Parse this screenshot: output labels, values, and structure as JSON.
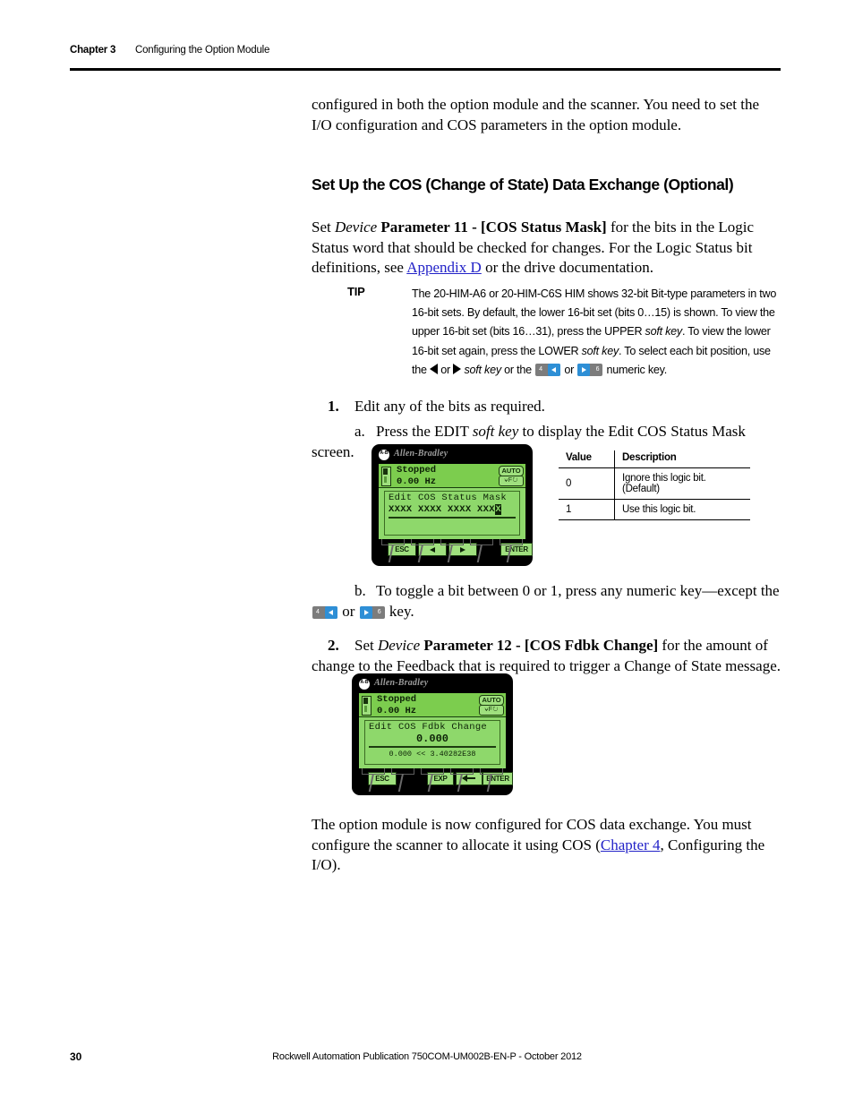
{
  "header": {
    "chapter": "Chapter 3",
    "title": "Configuring the Option Module"
  },
  "intro_paragraph": "configured in both the option module and the scanner. You need to set the I/O configuration and COS parameters in the option module.",
  "section": {
    "title": "Set Up the COS (Change of State) Data Exchange (Optional)",
    "para_set": "Set",
    "para_device": "Device",
    "para_param": "Parameter 11 - [COS Status Mask]",
    "para_rest1": " for the bits in the Logic Status word that should be checked for changes. For the Logic Status bit definitions, see ",
    "para_link": "Appendix D",
    "para_rest2": " or the drive documentation."
  },
  "tip": {
    "label": "TIP",
    "text_a": "The 20-HIM-A6 or 20-HIM-C6S HIM shows 32-bit Bit-type parameters in two 16-bit sets. By default, the lower 16-bit set (bits 0…15) is shown. To view the upper 16-bit set (bits 16…31), press the UPPER ",
    "soft_key_1": "soft key",
    "text_b": ". To view the lower 16-bit set again, press the LOWER ",
    "soft_key_2": "soft key",
    "text_c": ". To select each bit position, use the ",
    "text_d": " or ",
    "soft_key_3": "soft key",
    "text_e": " or the ",
    "text_f": " or ",
    "text_g": " numeric key.",
    "key_4_label": "4",
    "key_6_label": "6"
  },
  "steps": {
    "step1_num": "1.",
    "step1_text": "Edit any of the bits as required.",
    "step1a_num": "a.",
    "step1a_text_1": "Press the EDIT ",
    "step1a_italic": "soft key",
    "step1a_text_2": " to display the Edit COS Status Mask screen.",
    "step1b_num": "b.",
    "step1b_text_1": "To toggle a bit between 0 or 1, press any numeric key—except the ",
    "step1b_text_2": " or ",
    "step1b_text_3": " key.",
    "step2_num": "2.",
    "step2_set": "Set ",
    "step2_device": "Device",
    "step2_param": "Parameter 12 - [COS Fdbk Change]",
    "step2_rest": " for the amount of change to the Feedback that is required to trigger a Change of State message."
  },
  "him_1": {
    "brand": "Allen-Bradley",
    "logo_text": "A-B",
    "status_line_1": "Stopped",
    "status_line_2": "0.00 Hz",
    "auto_label": "AUTO",
    "mode_label": "F",
    "panel_title": "Edit COS Status Mask",
    "bits_value": "XXXX XXXX XXXX XXX",
    "bits_cursor": "X",
    "softkeys": [
      "ESC",
      "left-arrow",
      "right-arrow",
      "",
      "ENTER"
    ],
    "softkey_esc": "ESC",
    "softkey_enter": "ENTER"
  },
  "him_2": {
    "brand": "Allen-Bradley",
    "logo_text": "A-B",
    "status_line_1": "Stopped",
    "status_line_2": "0.00 Hz",
    "auto_label": "AUTO",
    "mode_label": "F",
    "panel_title": "Edit COS Fdbk Change",
    "value": "0.000",
    "range": "0.000 << 3.40282E38",
    "softkey_esc": "ESC",
    "softkey_exp": "EXP",
    "softkey_enter": "ENTER"
  },
  "value_table": {
    "headers": [
      "Value",
      "Description"
    ],
    "rows": [
      {
        "value": "0",
        "description": "Ignore this logic bit. (Default)"
      },
      {
        "value": "1",
        "description": "Use this logic bit."
      }
    ]
  },
  "closing": {
    "text_1": "The option module is now configured for COS data exchange. You must configure the scanner to allocate it using COS (",
    "link": "Chapter 4",
    "text_2": ", Configuring the I/O)."
  },
  "footer": {
    "page_number": "30",
    "publication": "Rockwell Automation Publication 750COM-UM002B-EN-P - October 2012"
  },
  "colors": {
    "link": "#2323c8",
    "lcd_background": "#8ed86b",
    "lcd_status_bar": "#7ccd4e",
    "key_chip_gray": "#7c7c7c",
    "key_chip_blue": "#2e8fd6"
  }
}
